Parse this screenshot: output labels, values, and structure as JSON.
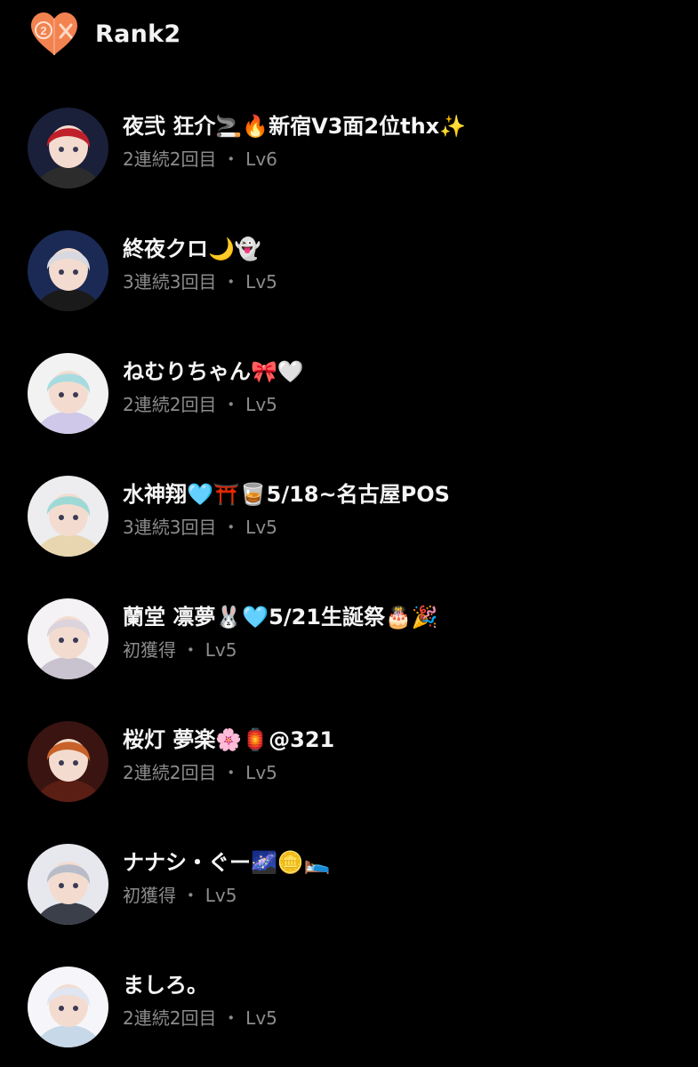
{
  "header": {
    "title": "Rank2",
    "badge_digit": "2",
    "badge_color": "#f2824f"
  },
  "list": {
    "items": [
      {
        "name": "夜弐 狂介🚬🔥新宿V3面2位thx✨",
        "status": "2連続2回目",
        "level": "Lv6",
        "avatar_colors": [
          "#1a1f3a",
          "#c0202a",
          "#2c2c2c"
        ]
      },
      {
        "name": "終夜クロ🌙👻",
        "status": "3連続3回目",
        "level": "Lv5",
        "avatar_colors": [
          "#1b2a55",
          "#d8d8e0",
          "#1a1a1a"
        ]
      },
      {
        "name": "ねむりちゃん🎀🤍",
        "status": "2連続2回目",
        "level": "Lv5",
        "avatar_colors": [
          "#f2f2f2",
          "#a8dbe0",
          "#cfc8e8"
        ]
      },
      {
        "name": "水神翔🩵⛩️🥃5/18~名古屋POS",
        "status": "3連続3回目",
        "level": "Lv5",
        "avatar_colors": [
          "#ededf0",
          "#9fd9d6",
          "#e8d6b0"
        ]
      },
      {
        "name": "蘭堂 凛夢🐰🩵5/21生誕祭🎂🎉",
        "status": "初獲得",
        "level": "Lv5",
        "avatar_colors": [
          "#f4f2f4",
          "#dcd4dc",
          "#c9c2cf"
        ]
      },
      {
        "name": "桜灯 夢楽🌸🏮@321",
        "status": "2連続2回目",
        "level": "Lv5",
        "avatar_colors": [
          "#3a1410",
          "#c8622a",
          "#5a1e14"
        ]
      },
      {
        "name": "ナナシ・ぐー🌌🪙🛌",
        "status": "初獲得",
        "level": "Lv5",
        "avatar_colors": [
          "#e6e8ee",
          "#b8bcc8",
          "#3b3f4a"
        ]
      },
      {
        "name": "ましろ。",
        "status": "2連続2回目",
        "level": "Lv5",
        "avatar_colors": [
          "#f6f6fa",
          "#dfe6f2",
          "#c7d8e8"
        ]
      }
    ],
    "separator": " ・ "
  }
}
